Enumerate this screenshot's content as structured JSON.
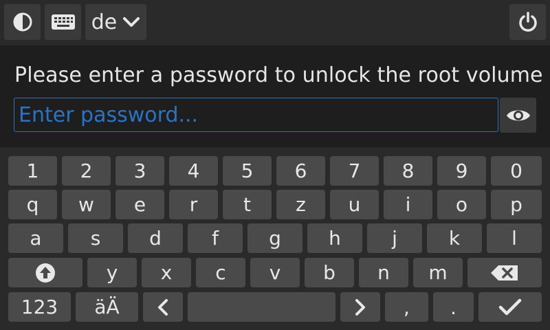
{
  "topbar": {
    "theme_icon": "half-circle-contrast-icon",
    "keyboard_icon": "keyboard-icon",
    "language": "de",
    "language_dropdown_icon": "chevron-down-icon",
    "power_icon": "power-icon"
  },
  "prompt": "Please enter a password to unlock the root volume",
  "password": {
    "placeholder": "Enter password...",
    "value": "",
    "toggle_icon": "eye-icon"
  },
  "keyboard": {
    "row1": [
      "1",
      "2",
      "3",
      "4",
      "5",
      "6",
      "7",
      "8",
      "9",
      "0"
    ],
    "row2": [
      "q",
      "w",
      "e",
      "r",
      "t",
      "z",
      "u",
      "i",
      "o",
      "p"
    ],
    "row3": [
      "a",
      "s",
      "d",
      "f",
      "g",
      "h",
      "j",
      "k",
      "l"
    ],
    "row4": [
      "y",
      "x",
      "c",
      "v",
      "b",
      "n",
      "m"
    ],
    "shift_icon": "shift-arrow-icon",
    "backspace_icon": "backspace-icon",
    "numbers_label": "123",
    "umlaut_label": "äÄ",
    "left_icon": "chevron-left-icon",
    "right_icon": "chevron-right-icon",
    "comma": ",",
    "period": ".",
    "enter_icon": "checkmark-icon"
  },
  "colors": {
    "background": "#1e1e1e",
    "bar": "#2a2a2a",
    "button": "#3a3a3a",
    "key": "#4a4a4a",
    "accent": "#2a73c6"
  }
}
